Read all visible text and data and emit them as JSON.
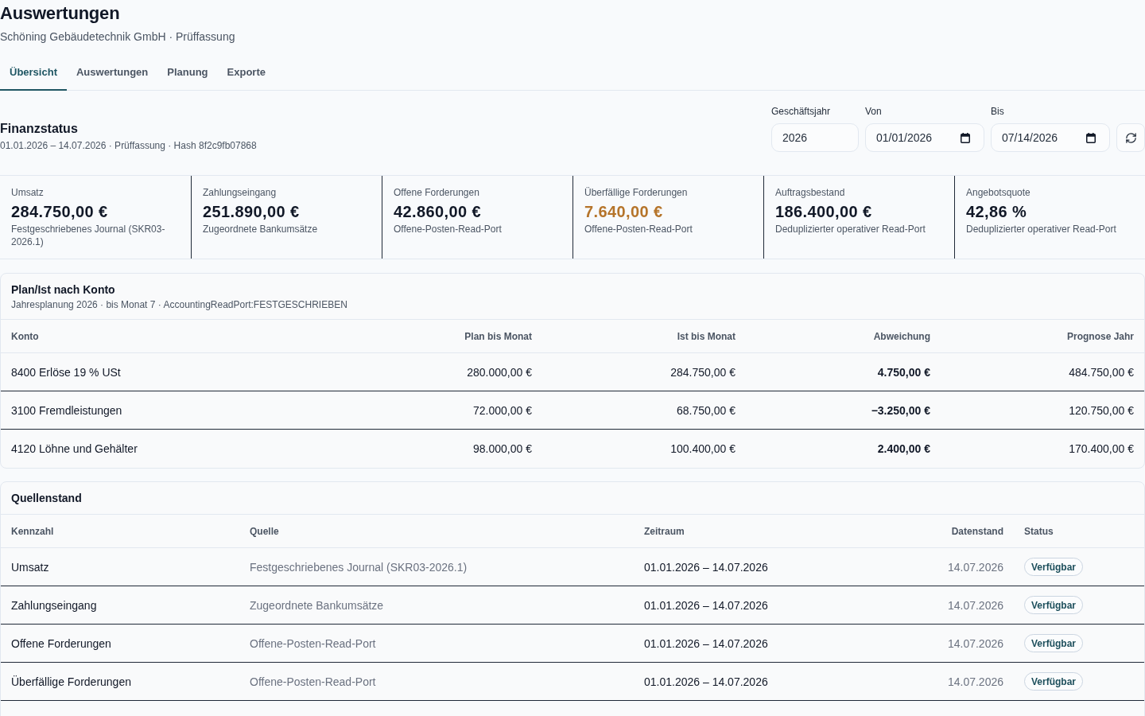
{
  "page": {
    "title": "Auswertungen",
    "subtitle": "Schöning Gebäudetechnik GmbH · Prüffassung"
  },
  "tabs": [
    {
      "label": "Übersicht",
      "selected": true
    },
    {
      "label": "Auswertungen",
      "selected": false
    },
    {
      "label": "Planung",
      "selected": false
    },
    {
      "label": "Exporte",
      "selected": false
    }
  ],
  "finanzstatus": {
    "title": "Finanzstatus",
    "meta": "01.01.2026 – 14.07.2026 · Prüffassung · Hash 8f2c9fb07868",
    "filters": [
      {
        "kind": "year",
        "label": "Geschäftsjahr",
        "value": "2026"
      },
      {
        "kind": "date",
        "label": "Von",
        "value": "01/01/2026"
      },
      {
        "kind": "date",
        "label": "Bis",
        "value": "07/14/2026"
      }
    ]
  },
  "kpis": [
    {
      "label": "Umsatz",
      "value": "284.750,00 €",
      "source": "Festgeschriebenes Journal (SKR03-2026.1)",
      "warning": false
    },
    {
      "label": "Zahlungseingang",
      "value": "251.890,00 €",
      "source": "Zugeordnete Bankumsätze",
      "warning": false
    },
    {
      "label": "Offene Forderungen",
      "value": "42.860,00 €",
      "source": "Offene-Posten-Read-Port",
      "warning": false
    },
    {
      "label": "Überfällige Forderungen",
      "value": "7.640,00 €",
      "source": "Offene-Posten-Read-Port",
      "warning": true
    },
    {
      "label": "Auftragsbestand",
      "value": "186.400,00 €",
      "source": "Deduplizierter operativer Read-Port",
      "warning": false
    },
    {
      "label": "Angebotsquote",
      "value": "42,86 %",
      "source": "Deduplizierter operativer Read-Port",
      "warning": false
    }
  ],
  "plan_table": {
    "title": "Plan/Ist nach Konto",
    "subtitle": "Jahresplanung 2026 · bis Monat 7 · AccountingReadPort:FESTGESCHRIEBEN",
    "columns": [
      {
        "label": "Konto",
        "kind": "text"
      },
      {
        "label": "Plan bis Monat",
        "kind": "amount"
      },
      {
        "label": "Ist bis Monat",
        "kind": "amount"
      },
      {
        "label": "Abweichung",
        "kind": "delta"
      },
      {
        "label": "Prognose Jahr",
        "kind": "amount"
      }
    ],
    "rows": [
      {
        "cells": [
          "8400 Erlöse 19 % USt",
          "280.000,00 €",
          "284.750,00 €",
          "4.750,00 €",
          "484.750,00 €"
        ]
      },
      {
        "cells": [
          "3100 Fremdleistungen",
          "72.000,00 €",
          "68.750,00 €",
          "−3.250,00 €",
          "120.750,00 €"
        ]
      },
      {
        "cells": [
          "4120 Löhne und Gehälter",
          "98.000,00 €",
          "100.400,00 €",
          "2.400,00 €",
          "170.400,00 €"
        ]
      }
    ]
  },
  "sources_table": {
    "title": "Quellenstand",
    "columns": [
      {
        "label": "Kennzahl",
        "kind": "name"
      },
      {
        "label": "Quelle",
        "kind": "source"
      },
      {
        "label": "Zeitraum",
        "kind": "period"
      },
      {
        "label": "Datenstand",
        "kind": "date"
      },
      {
        "label": "Status",
        "kind": "status"
      }
    ],
    "rows": [
      {
        "cells": [
          "Umsatz",
          "Festgeschriebenes Journal (SKR03-2026.1)",
          "01.01.2026 – 14.07.2026",
          "14.07.2026",
          "Verfügbar"
        ]
      },
      {
        "cells": [
          "Zahlungseingang",
          "Zugeordnete Bankumsätze",
          "01.01.2026 – 14.07.2026",
          "14.07.2026",
          "Verfügbar"
        ]
      },
      {
        "cells": [
          "Offene Forderungen",
          "Offene-Posten-Read-Port",
          "01.01.2026 – 14.07.2026",
          "14.07.2026",
          "Verfügbar"
        ]
      },
      {
        "cells": [
          "Überfällige Forderungen",
          "Offene-Posten-Read-Port",
          "01.01.2026 – 14.07.2026",
          "14.07.2026",
          "Verfügbar"
        ]
      }
    ]
  }
}
